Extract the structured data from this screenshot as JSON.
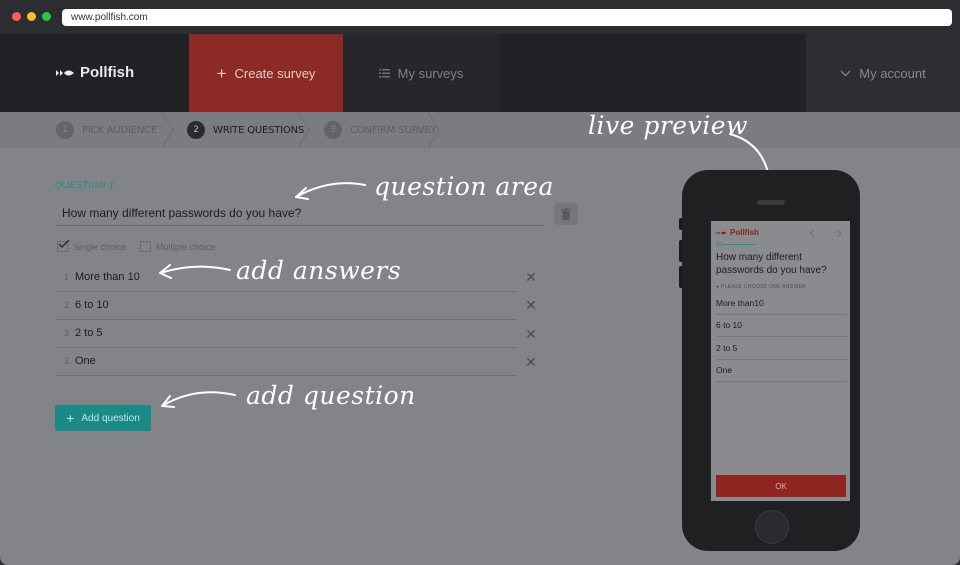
{
  "browser": {
    "url": "www.pollfish.com",
    "dot_colors": [
      "#ff5f57",
      "#febc2e",
      "#28c840"
    ]
  },
  "nav": {
    "logo": "Pollfish",
    "create": "Create survey",
    "surveys": "My surveys",
    "account": "My account"
  },
  "steps": [
    {
      "num": "1",
      "label": "PICK AUDIENCE"
    },
    {
      "num": "2",
      "label": "WRITE QUESTIONS"
    },
    {
      "num": "3",
      "label": "CONFIRM SURVEY"
    }
  ],
  "question": {
    "label": "QUESTION 1",
    "text": "How many different passwords do you have?",
    "single_choice": "Single choice",
    "multiple_choice": "Multiple choice",
    "selected_type": "Single choice",
    "answers": [
      {
        "idx": "1",
        "text": "More than 10"
      },
      {
        "idx": "2",
        "text": "6 to 10"
      },
      {
        "idx": "3",
        "text": "2 to 5"
      },
      {
        "idx": "3",
        "text": "One"
      }
    ],
    "add_button": "Add question"
  },
  "annotations": {
    "question_area": "question area",
    "add_answers": "add answers",
    "add_question": "add question",
    "live_preview": "live preview"
  },
  "preview": {
    "logo": "Pollfish",
    "progress": "1/1",
    "question": "How many different passwords do you have?",
    "hint": "PLEASE CHOOSE ONE ANSWER",
    "options": [
      "More than10",
      "6 to 10",
      "2 to 5",
      "One"
    ],
    "ok": "OK"
  },
  "colors": {
    "accent_red": "#8c2a25",
    "accent_teal": "#1b8a86"
  }
}
